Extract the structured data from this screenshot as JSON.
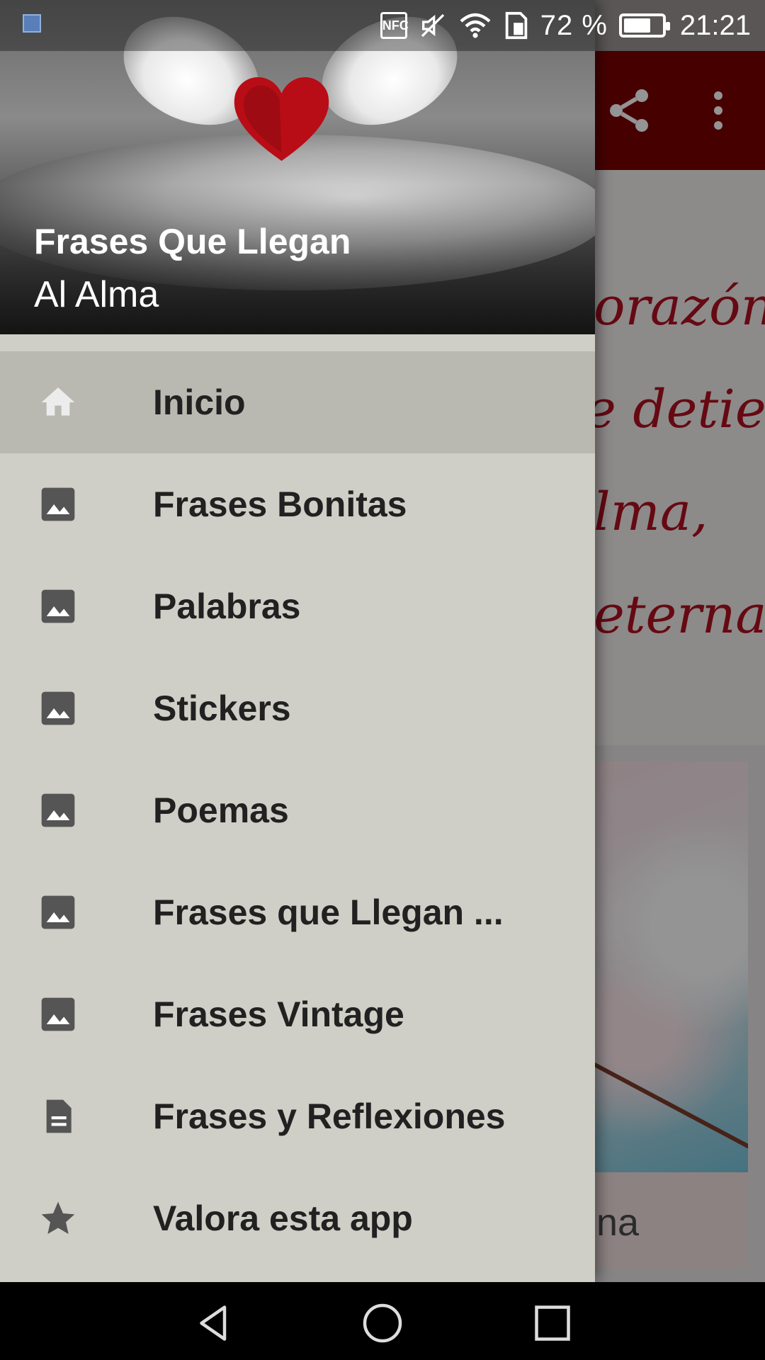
{
  "status_bar": {
    "battery_percent": "72 %",
    "battery_level": 0.72,
    "time": "21:21",
    "icons": [
      "notification-icon",
      "nfc-icon",
      "muted-icon",
      "wifi-icon",
      "sim-icon",
      "battery-icon"
    ]
  },
  "background_app": {
    "toolbar_color": "#7a0000",
    "quote_lines": [
      "orazón",
      "e detiene.",
      "lma,",
      "eterna."
    ],
    "card_caption": "na"
  },
  "drawer": {
    "header": {
      "title": "Frases Que Llegan",
      "subtitle": "Al Alma"
    },
    "items": [
      {
        "label": "Inicio",
        "icon": "home-icon",
        "active": true
      },
      {
        "label": "Frases Bonitas",
        "icon": "image-icon",
        "active": false
      },
      {
        "label": "Palabras",
        "icon": "image-icon",
        "active": false
      },
      {
        "label": "Stickers",
        "icon": "image-icon",
        "active": false
      },
      {
        "label": "Poemas",
        "icon": "image-icon",
        "active": false
      },
      {
        "label": "Frases que Llegan ...",
        "icon": "image-icon",
        "active": false
      },
      {
        "label": "Frases Vintage",
        "icon": "image-icon",
        "active": false
      },
      {
        "label": "Frases y Reflexiones",
        "icon": "document-icon",
        "active": false
      },
      {
        "label": "Valora esta app",
        "icon": "star-icon",
        "active": false
      }
    ]
  },
  "nav_bar": {
    "buttons": [
      "back-icon",
      "home-circle-icon",
      "recents-icon"
    ]
  }
}
